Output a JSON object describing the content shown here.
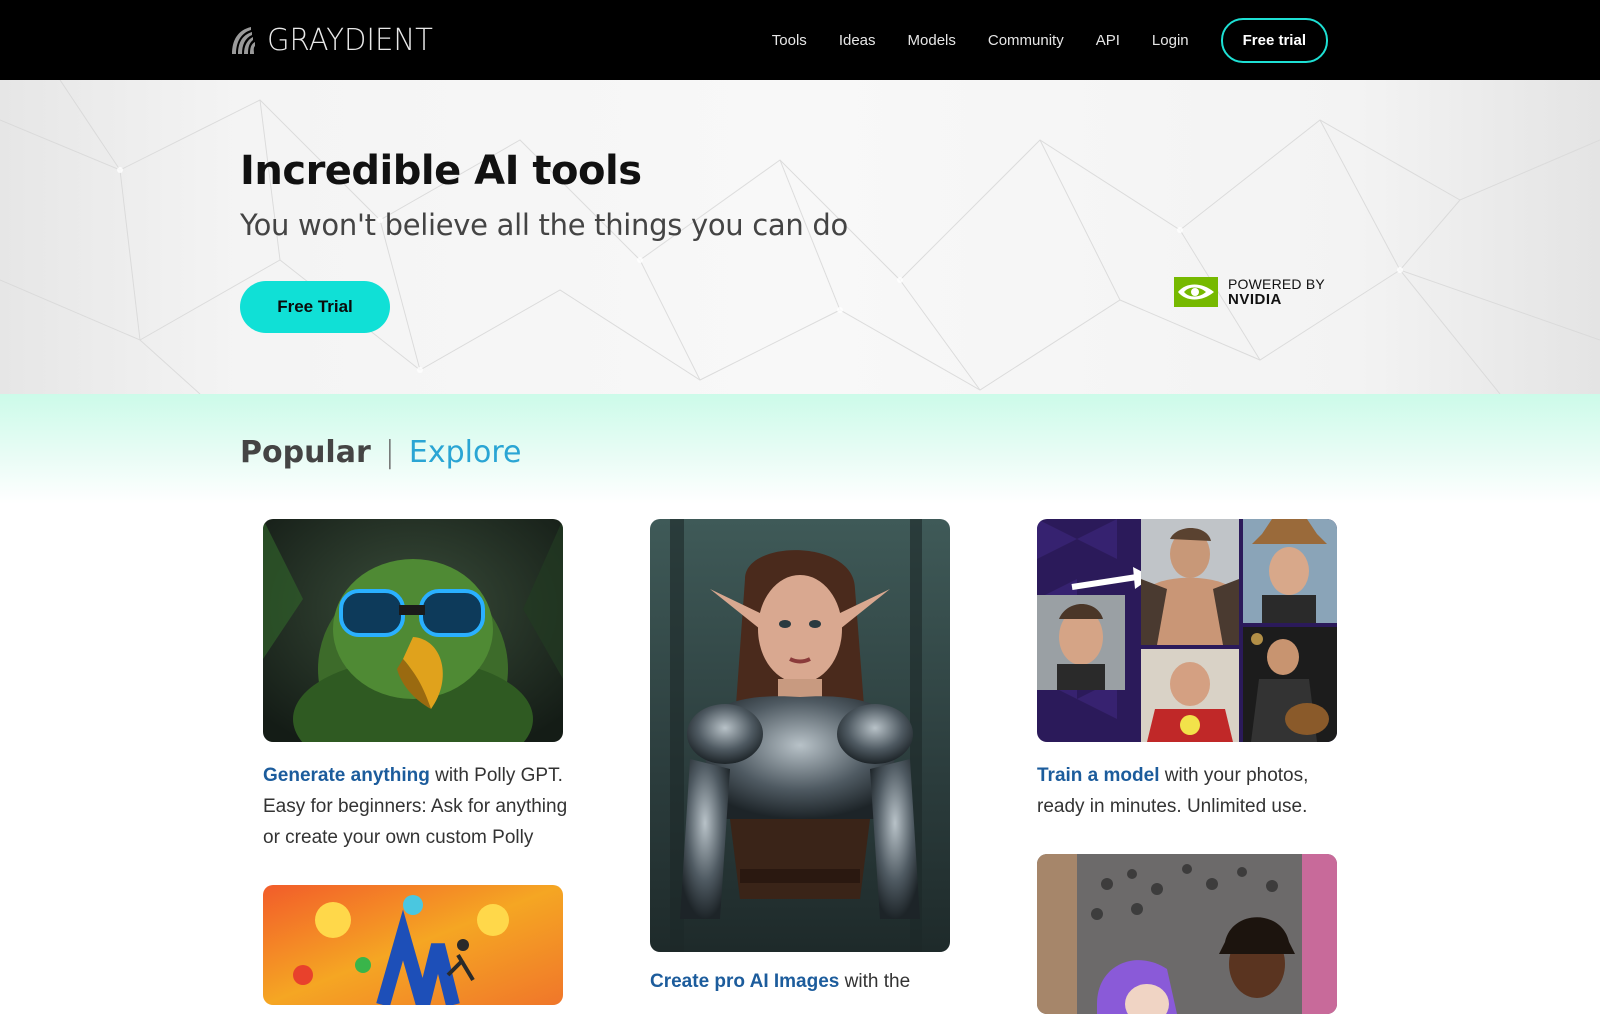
{
  "header": {
    "logo_text": "GRAYDIENT",
    "nav": [
      "Tools",
      "Ideas",
      "Models",
      "Community",
      "API",
      "Login"
    ],
    "cta": "Free trial"
  },
  "hero": {
    "title": "Incredible AI tools",
    "subtitle": "You won't believe all the things you can do",
    "cta": "Free Trial",
    "badge_line1": "POWERED BY",
    "badge_line2": "NVIDIA"
  },
  "tabs": {
    "popular": "Popular",
    "separator": "|",
    "explore": "Explore"
  },
  "cards": [
    {
      "highlight": "Generate anything",
      "text": " with Polly GPT. Easy for beginners: Ask for anything or create your own custom Polly",
      "image": "green parrot with blue goggles"
    },
    {
      "highlight": "Create pro AI Images",
      "text": " with the",
      "image": "elf woman in armor"
    },
    {
      "highlight": "Train a model",
      "text": " with your photos, ready in minutes. Unlimited use.",
      "image": "photo collage of a man"
    },
    {
      "image": "colorful abstract illustration"
    },
    {
      "image": "portrait of two people in a crowd"
    }
  ],
  "colors": {
    "accent": "#10e0d6",
    "link": "#1c5c9c",
    "explore": "#2aa5d4",
    "nvidia": "#76b900"
  }
}
